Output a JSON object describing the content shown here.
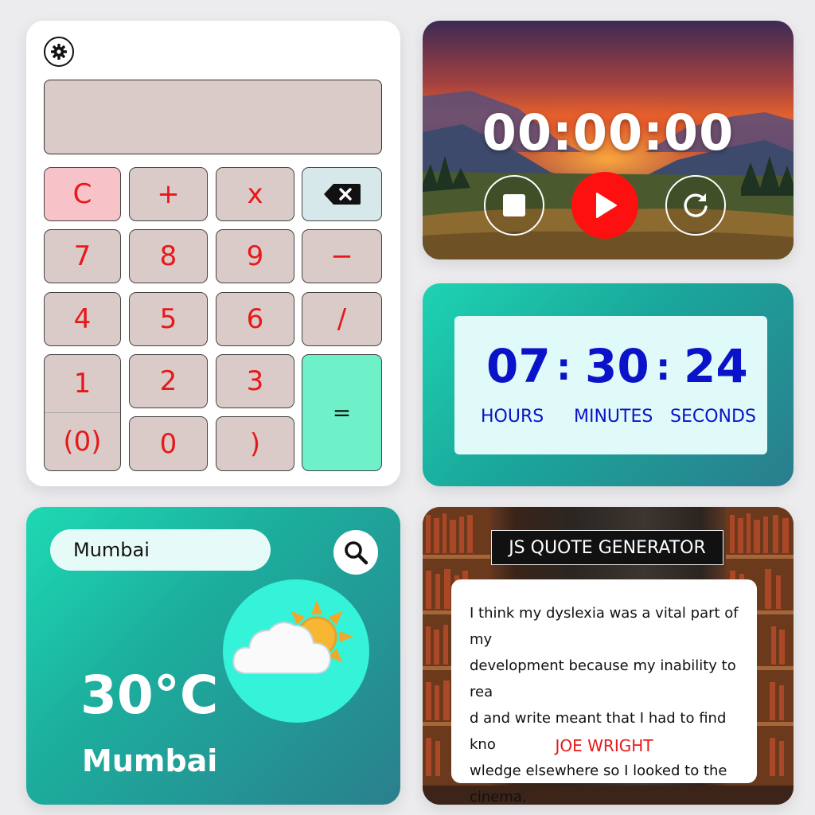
{
  "calculator": {
    "keys": {
      "clear": "C",
      "plus": "+",
      "multiply": "x",
      "seven": "7",
      "eight": "8",
      "nine": "9",
      "minus": "−",
      "four": "4",
      "five": "5",
      "six": "6",
      "divide": "/",
      "one": "1",
      "open_paren": "(0)",
      "two": "2",
      "three": "3",
      "zero": "0",
      "close_paren": ")",
      "equals": "="
    },
    "icons": {
      "settings": "gear-icon",
      "backspace": "backspace-icon"
    }
  },
  "stopwatch": {
    "time": "00:00:00",
    "icons": {
      "stop": "stop-icon",
      "play": "play-icon",
      "reset": "reset-icon"
    },
    "colors": {
      "play": "#ff1010"
    }
  },
  "clock": {
    "hours": "07",
    "minutes": "30",
    "seconds": "24",
    "separator": ":",
    "hours_label": "HOURS",
    "minutes_label": "MINUTES",
    "seconds_label": "SECONDS",
    "colors": {
      "digits": "#0a13c9"
    }
  },
  "weather": {
    "search_value": "Mumbai",
    "temperature": "30°C",
    "city": "Mumbai",
    "icons": {
      "search": "search-icon",
      "condition": "partly-cloudy-icon"
    }
  },
  "quote": {
    "title": "JS QUOTE GENERATOR",
    "lines": [
      "I think my dyslexia was a vital part of my",
      "development because my inability to rea",
      "d and write meant that I had to find kno",
      "wledge elsewhere so I looked to the",
      "cinema."
    ],
    "author": "JOE WRIGHT",
    "colors": {
      "author": "#e8181a"
    }
  }
}
